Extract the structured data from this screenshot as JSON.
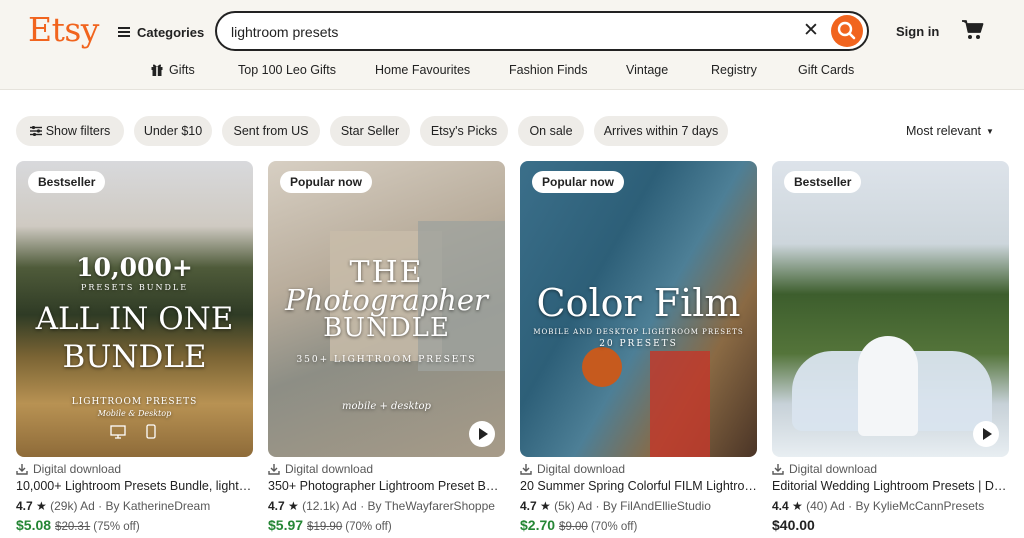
{
  "header": {
    "logo": "Etsy",
    "categories_label": "Categories",
    "search_value": "lightroom presets",
    "signin_label": "Sign in"
  },
  "nav": {
    "items": [
      "Gifts",
      "Top 100 Leo Gifts",
      "Home Favourites",
      "Fashion Finds",
      "Vintage",
      "Registry",
      "Gift Cards"
    ]
  },
  "filters": {
    "chips": [
      "Show filters",
      "Under $10",
      "Sent from US",
      "Star Seller",
      "Etsy's Picks",
      "On sale",
      "Arrives within 7 days"
    ],
    "sort_label": "Most relevant"
  },
  "listings": [
    {
      "badge": "Bestseller",
      "overlay": [
        "10,000+",
        "PRESETS BUNDLE",
        "ALL IN ONE",
        "BUNDLE",
        "LIGHTROOM PRESETS",
        "Mobile & Desktop"
      ],
      "delivery": "Digital download",
      "title": "10,000+ Lightroom Presets Bundle, lightroom...",
      "rating": "4.7",
      "reviews": "(29k)",
      "ad": "Ad",
      "shop": "By KatherineDream",
      "price": "$5.08",
      "original_price": "$20.31",
      "discount": "(75% off)"
    },
    {
      "badge": "Popular now",
      "overlay": [
        "THE",
        "Photographer",
        "BUNDLE",
        "350+ LIGHTROOM PRESETS",
        "mobile + desktop"
      ],
      "delivery": "Digital download",
      "title": "350+ Photographer Lightroom Preset Bundle...",
      "rating": "4.7",
      "reviews": "(12.1k)",
      "ad": "Ad",
      "shop": "By TheWayfarerShoppe",
      "price": "$5.97",
      "original_price": "$19.90",
      "discount": "(70% off)"
    },
    {
      "badge": "Popular now",
      "overlay": [
        "Color Film",
        "MOBILE AND DESKTOP LIGHTROOM PRESETS",
        "20 PRESETS"
      ],
      "delivery": "Digital download",
      "title": "20 Summer Spring Colorful FILM Lightroom...",
      "rating": "4.7",
      "reviews": "(5k)",
      "ad": "Ad",
      "shop": "By FilAndEllieStudio",
      "price": "$2.70",
      "original_price": "$9.00",
      "discount": "(70% off)"
    },
    {
      "badge": "Bestseller",
      "overlay": [],
      "delivery": "Digital download",
      "title": "Editorial Wedding Lightroom Presets | DE...",
      "rating": "4.4",
      "reviews": "(40)",
      "ad": "Ad",
      "shop": "By KylieMcCannPresets",
      "price": "$40.00",
      "original_price": "",
      "discount": ""
    }
  ],
  "colors": {
    "brand": "#f1641e",
    "sale_price": "#258635",
    "header_bg": "#f7f5f0",
    "chip_bg": "#eeece8"
  },
  "icons": [
    "hamburger-icon",
    "clear-icon",
    "search-icon",
    "cart-icon",
    "gift-icon",
    "filter-icon",
    "caret-down-icon",
    "download-icon",
    "star-icon",
    "play-icon"
  ]
}
